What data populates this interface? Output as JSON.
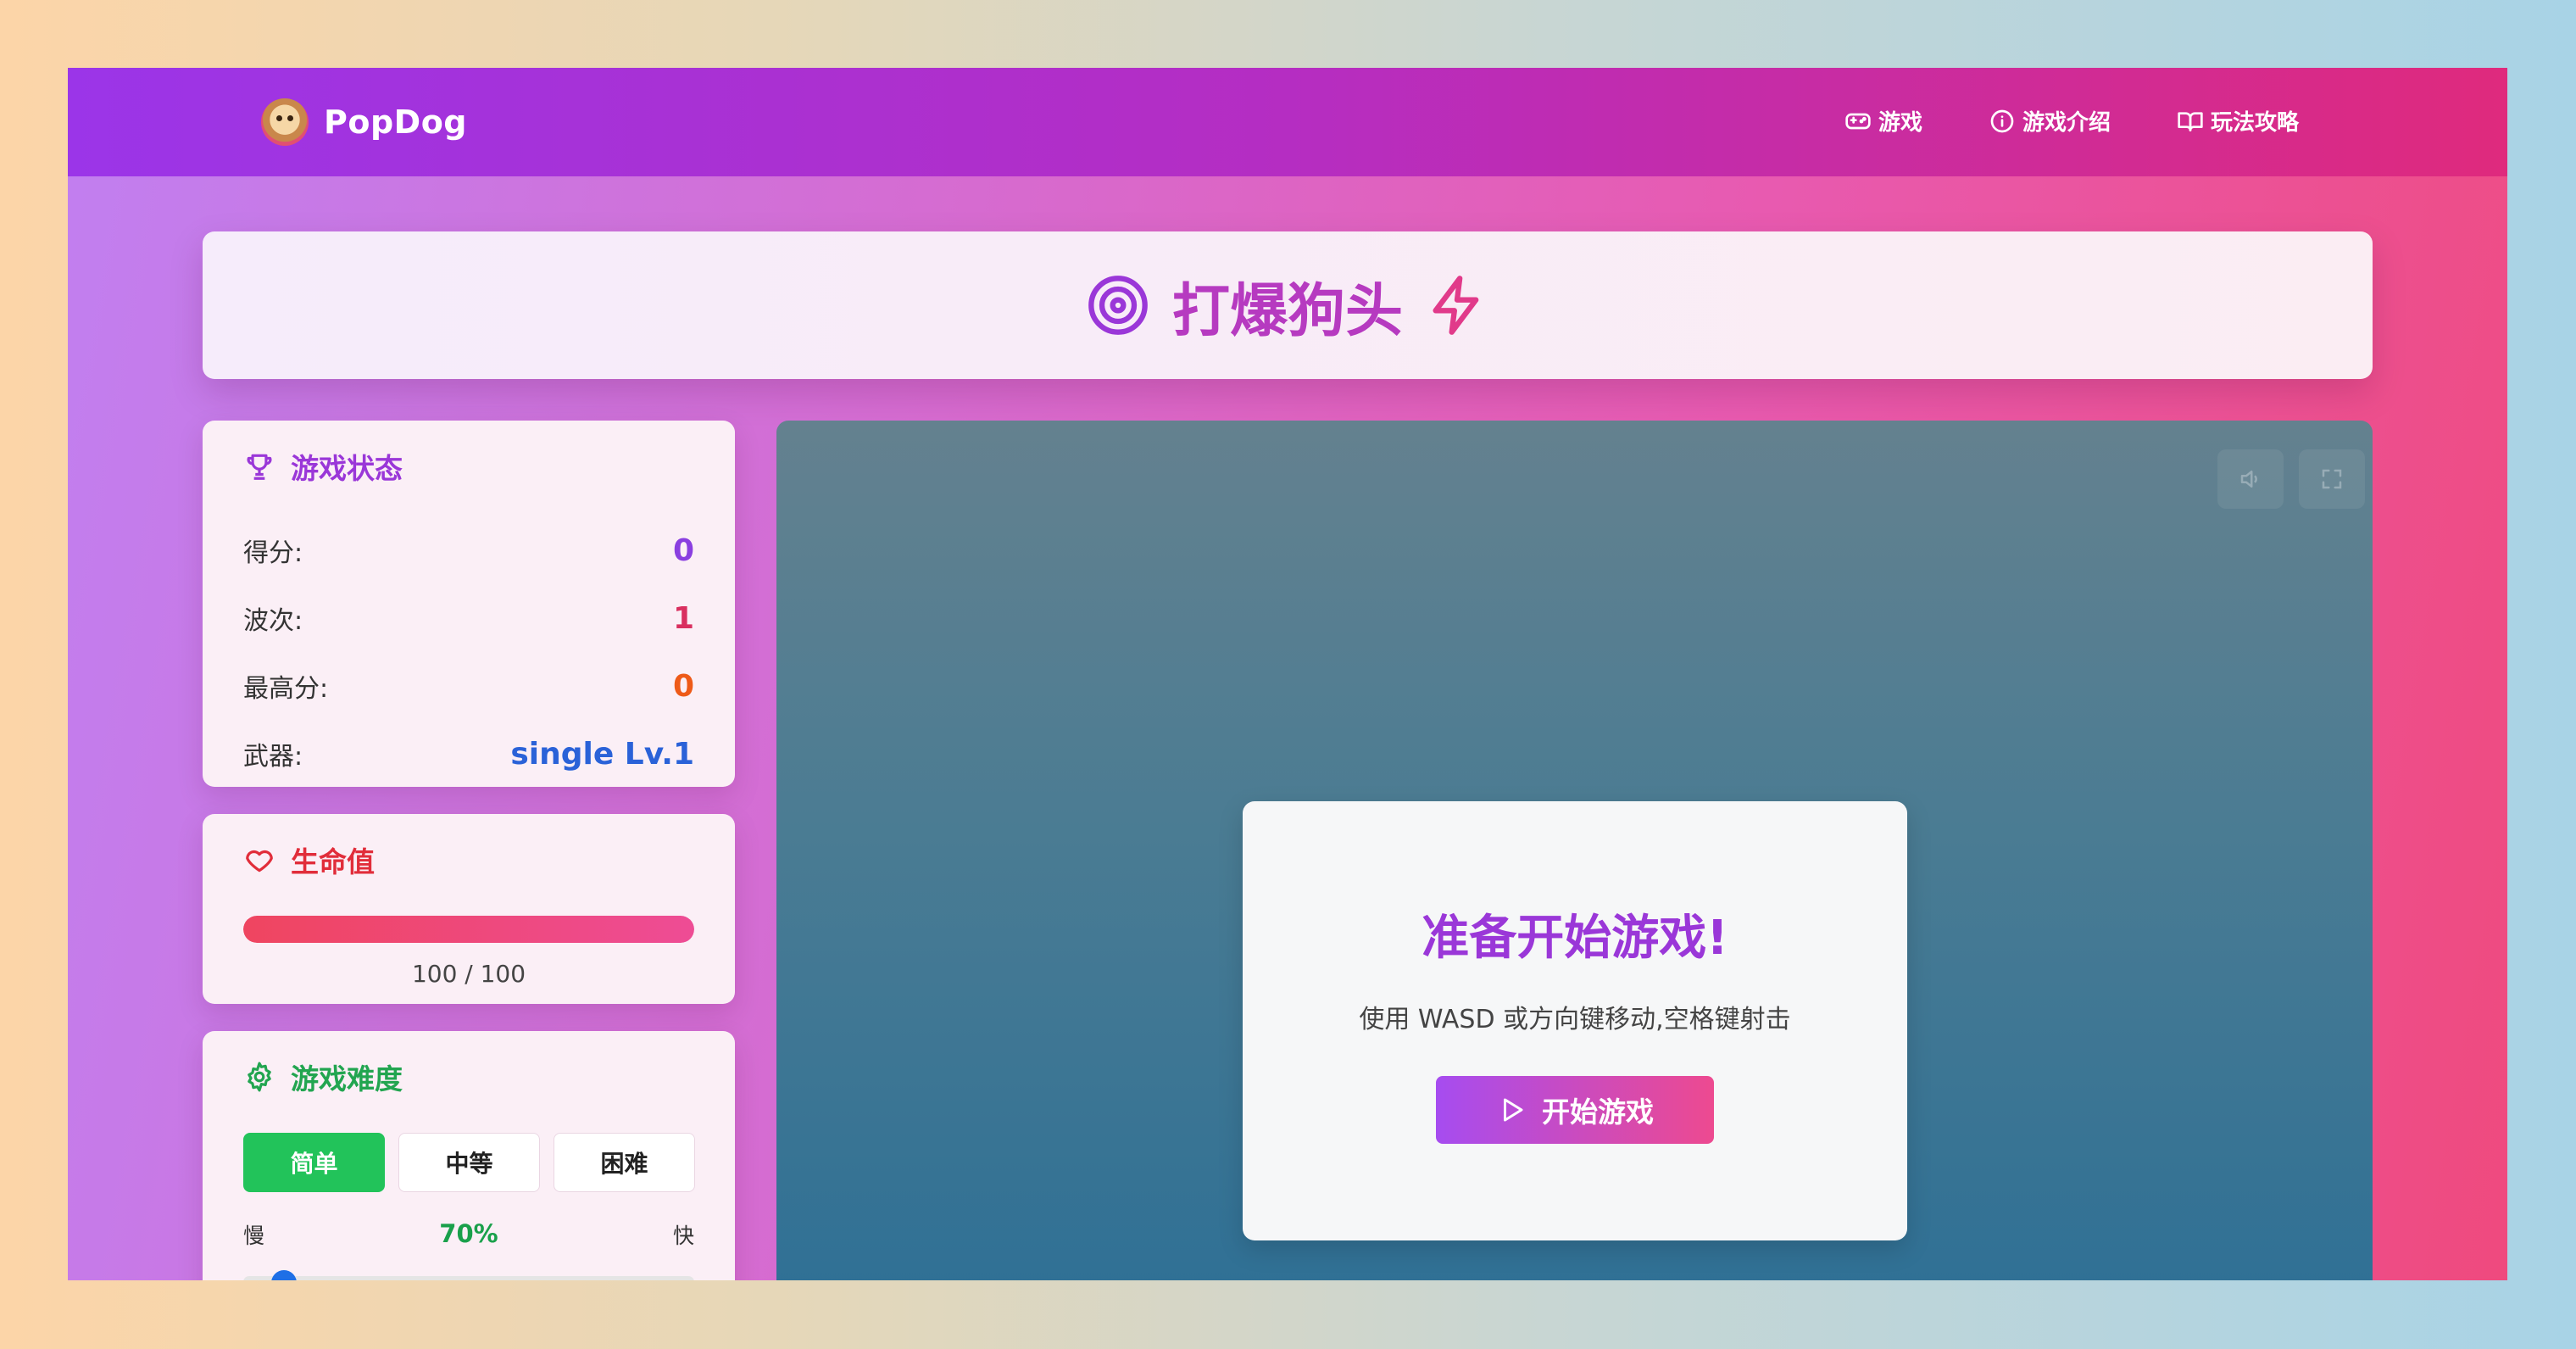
{
  "brand": {
    "name": "PopDog"
  },
  "nav": [
    {
      "label": "游戏",
      "icon": "gamepad-icon"
    },
    {
      "label": "游戏介绍",
      "icon": "info-icon"
    },
    {
      "label": "玩法攻略",
      "icon": "book-icon"
    }
  ],
  "title": {
    "text": "打爆狗头"
  },
  "status": {
    "heading": "游戏状态",
    "rows": [
      {
        "label": "得分:",
        "value": "0",
        "color": "#8a3fe0"
      },
      {
        "label": "波次:",
        "value": "1",
        "color": "#d92f5f"
      },
      {
        "label": "最高分:",
        "value": "0",
        "color": "#ee5a18"
      },
      {
        "label": "武器:",
        "value": "single Lv.1",
        "color": "#2a62d8"
      }
    ]
  },
  "health": {
    "heading": "生命值",
    "current": 100,
    "max": 100,
    "text": "100 / 100",
    "fraction": 1.0
  },
  "difficulty": {
    "heading": "游戏难度",
    "options": [
      "简单",
      "中等",
      "困难"
    ],
    "selected": "简单",
    "speed_slow": "慢",
    "speed_fast": "快",
    "speed_percent": "70%",
    "slider_fraction": 0.09
  },
  "game": {
    "start_title": "准备开始游戏!",
    "start_hint": "使用 WASD 或方向键移动,空格键射击",
    "start_button": "开始游戏"
  },
  "colors": {
    "accent_purple": "#9a37d8",
    "accent_pink": "#e13a8a",
    "health_red": "#e12d3a",
    "difficulty_green": "#22a550"
  }
}
